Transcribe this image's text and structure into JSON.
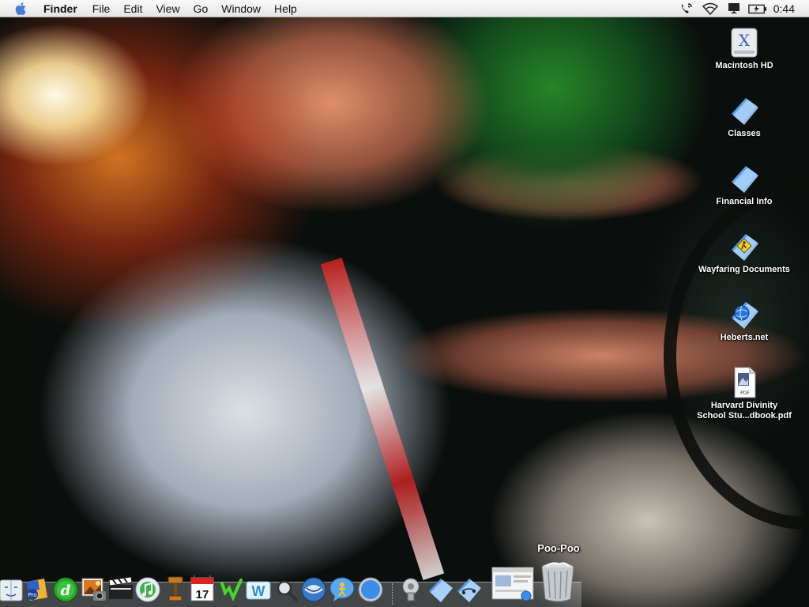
{
  "menubar": {
    "app_name": "Finder",
    "menus": [
      "File",
      "Edit",
      "View",
      "Go",
      "Window",
      "Help"
    ],
    "clock": "0:44",
    "status_icons": [
      "phone-icon",
      "wifi-icon",
      "display-icon",
      "battery-icon"
    ]
  },
  "desktop": {
    "icons": [
      {
        "label": "Macintosh HD",
        "icon": "hard-drive-icon"
      },
      {
        "label": "Classes",
        "icon": "folder-icon"
      },
      {
        "label": "Financial Info",
        "icon": "folder-icon"
      },
      {
        "label": "Wayfaring Documents",
        "icon": "folder-icon"
      },
      {
        "label": "Heberts.net",
        "icon": "globe-icon"
      },
      {
        "label": "Harvard Divinity\nSchool Stu...dbook.pdf",
        "icon": "pdf-icon"
      }
    ]
  },
  "dock": {
    "tooltip": "Poo-Poo",
    "apps": [
      {
        "name": "finder-icon"
      },
      {
        "name": "final-cut-pro-icon"
      },
      {
        "name": "dreamweaver-icon"
      },
      {
        "name": "iphoto-icon"
      },
      {
        "name": "imovie-icon"
      },
      {
        "name": "itunes-icon"
      },
      {
        "name": "podcast-icon"
      },
      {
        "name": "ical-icon",
        "text": "17"
      },
      {
        "name": "brand-logo-icon"
      },
      {
        "name": "text-tool-icon"
      },
      {
        "name": "spotlight-icon"
      },
      {
        "name": "thunderbird-icon"
      },
      {
        "name": "ichat-icon"
      },
      {
        "name": "safari-icon"
      }
    ],
    "others": [
      {
        "name": "system-preferences-icon"
      },
      {
        "name": "documents-stack-icon"
      },
      {
        "name": "network-icon"
      },
      {
        "name": "window-preview-icon"
      },
      {
        "name": "trash-icon"
      }
    ],
    "colors": {
      "accent": "#3a7bd5",
      "folder": "#7fb4f2"
    }
  }
}
